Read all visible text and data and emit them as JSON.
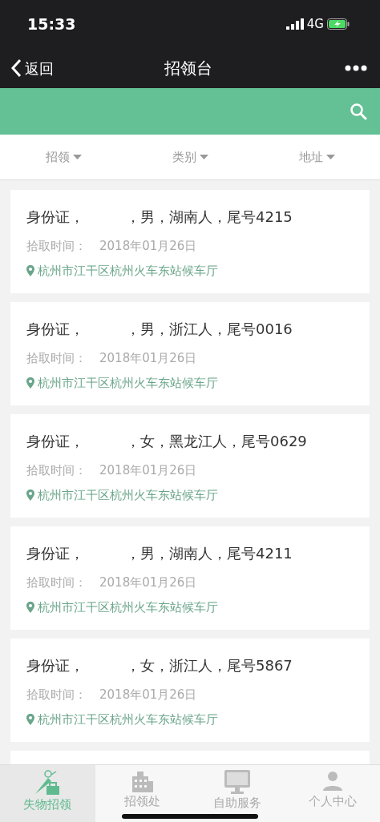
{
  "status_bar": {
    "time": "15:33",
    "network": "4G"
  },
  "nav_bar": {
    "back": "返回",
    "title": "招领台"
  },
  "filters": [
    {
      "label": "招领"
    },
    {
      "label": "类别"
    },
    {
      "label": "地址"
    }
  ],
  "items": [
    {
      "title_parts": [
        "身份证，",
        "，男，湖南人，尾号4215"
      ],
      "pickup_label": "拾取时间：",
      "pickup_date": "2018年01月26日",
      "location": "杭州市江干区杭州火车东站候车厅"
    },
    {
      "title_parts": [
        "身份证，",
        "，男，浙江人，尾号0016"
      ],
      "pickup_label": "拾取时间：",
      "pickup_date": "2018年01月26日",
      "location": "杭州市江干区杭州火车东站候车厅"
    },
    {
      "title_parts": [
        "身份证，",
        "，女，黑龙江人，尾号0629"
      ],
      "pickup_label": "拾取时间：",
      "pickup_date": "2018年01月26日",
      "location": "杭州市江干区杭州火车东站候车厅"
    },
    {
      "title_parts": [
        "身份证，",
        "，男，湖南人，尾号4211"
      ],
      "pickup_label": "拾取时间：",
      "pickup_date": "2018年01月26日",
      "location": "杭州市江干区杭州火车东站候车厅"
    },
    {
      "title_parts": [
        "身份证，",
        "，女，浙江人，尾号5867"
      ],
      "pickup_label": "拾取时间：",
      "pickup_date": "2018年01月26日",
      "location": "杭州市江干区杭州火车东站候车厅"
    }
  ],
  "tabs": [
    {
      "label": "失物招领",
      "kind": "lost",
      "selected": true
    },
    {
      "label": "招领处",
      "kind": "office",
      "selected": false
    },
    {
      "label": "自助服务",
      "kind": "service",
      "selected": false
    },
    {
      "label": "个人中心",
      "kind": "profile",
      "selected": false
    }
  ]
}
